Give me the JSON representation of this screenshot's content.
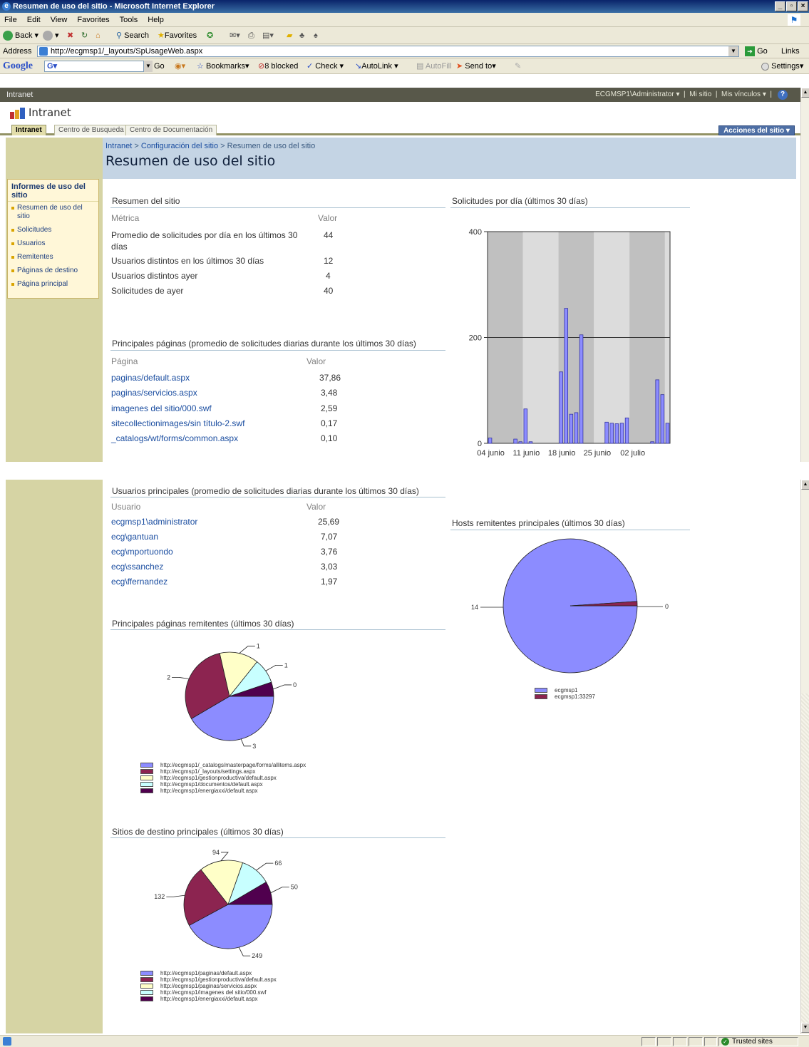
{
  "window": {
    "title": "Resumen de uso del sitio - Microsoft Internet Explorer"
  },
  "menu": [
    "File",
    "Edit",
    "View",
    "Favorites",
    "Tools",
    "Help"
  ],
  "toolbar": {
    "back": "Back",
    "search": "Search",
    "favorites": "Favorites"
  },
  "address": {
    "label": "Address",
    "url": "http://ecgmsp1/_layouts/SpUsageWeb.aspx",
    "go": "Go",
    "links": "Links"
  },
  "google": {
    "logo": "Google",
    "go": "Go",
    "bookmarks": "Bookmarks",
    "blocked": "8 blocked",
    "check": "Check",
    "autolink": "AutoLink",
    "autofill": "AutoFill",
    "sendto": "Send to",
    "settings": "Settings"
  },
  "sp": {
    "top_label": "Intranet",
    "user": "ECGMSP1\\Administrator",
    "mi_sitio": "Mi sitio",
    "mis_vinculos": "Mis vínculos",
    "site_title": "Intranet",
    "tabs": [
      "Intranet",
      "Centro de Busqueda",
      "Centro de Documentación"
    ],
    "acciones": "Acciones del sitio",
    "breadcrumb": {
      "a": "Intranet",
      "b": "Configuración del sitio",
      "c": "Resumen de uso del sitio",
      "sep": ">"
    },
    "page_title": "Resumen de uso del sitio"
  },
  "quick_launch": {
    "heading": "Informes de uso del sitio",
    "items": [
      "Resumen de uso del sitio",
      "Solicitudes",
      "Usuarios",
      "Remitentes",
      "Páginas de destino",
      "Página principal"
    ]
  },
  "resumen": {
    "heading": "Resumen del sitio",
    "col_metric": "Métrica",
    "col_value": "Valor",
    "rows": [
      {
        "metric": "Promedio de solicitudes por día en los últimos 30 días",
        "value": "44"
      },
      {
        "metric": "Usuarios distintos en los últimos 30 días",
        "value": "12"
      },
      {
        "metric": "Usuarios distintos ayer",
        "value": "4"
      },
      {
        "metric": "Solicitudes de ayer",
        "value": "40"
      }
    ]
  },
  "paginas": {
    "heading": "Principales páginas (promedio de solicitudes diarias durante los últimos 30 días)",
    "col_page": "Página",
    "col_value": "Valor",
    "rows": [
      {
        "page": "paginas/default.aspx",
        "value": "37,86"
      },
      {
        "page": "paginas/servicios.aspx",
        "value": "3,48"
      },
      {
        "page": "imagenes del sitio/000.swf",
        "value": "2,59"
      },
      {
        "page": "sitecollectionimages/sin título-2.swf",
        "value": "0,17"
      },
      {
        "page": "_catalogs/wt/forms/common.aspx",
        "value": "0,10"
      }
    ]
  },
  "usuarios": {
    "heading": "Usuarios principales (promedio de solicitudes diarias durante los últimos 30 días)",
    "col_user": "Usuario",
    "col_value": "Valor",
    "rows": [
      {
        "user": "ecgmsp1\\administrator",
        "value": "25,69"
      },
      {
        "user": "ecg\\gantuan",
        "value": "7,07"
      },
      {
        "user": "ecg\\mportuondo",
        "value": "3,76"
      },
      {
        "user": "ecg\\ssanchez",
        "value": "3,03"
      },
      {
        "user": "ecg\\ffernandez",
        "value": "1,97"
      }
    ]
  },
  "colors": {
    "blue": "#8c8cff",
    "maroon": "#8c2450",
    "yellow": "#ffffc8",
    "cyan": "#c8ffff",
    "purple": "#50004e",
    "band_dark": "#c0c0c0",
    "band_light": "#dcdcdc"
  },
  "chart_data": [
    {
      "type": "bar",
      "title": "Solicitudes por día (últimos 30 días)",
      "ylim": [
        0,
        400
      ],
      "yticks": [
        "0",
        "200",
        "400"
      ],
      "xticks": [
        "04 junio",
        "11 junio",
        "18 junio",
        "25 junio",
        "02 julio"
      ],
      "values": [
        10,
        0,
        0,
        0,
        0,
        8,
        3,
        65,
        3,
        0,
        0,
        0,
        0,
        0,
        135,
        255,
        55,
        58,
        205,
        0,
        0,
        0,
        0,
        40,
        38,
        37,
        38,
        48,
        0,
        0,
        0,
        0,
        3,
        120,
        92,
        38
      ]
    },
    {
      "type": "pie",
      "title": "Principales páginas remitentes (últimos 30 días)",
      "categories": [
        "http://ecgmsp1/_catalogs/masterpage/forms/allitems.aspx",
        "http://ecgmsp1/_layouts/settings.aspx",
        "http://ecgmsp1/gestionproductiva/default.aspx",
        "http://ecgmsp1/documentos/default.aspx",
        "http://ecgmsp1/energiaxxi/default.aspx"
      ],
      "labels": [
        "3",
        "2",
        "1",
        "1",
        "0"
      ],
      "values": [
        3.2,
        2.3,
        1.1,
        0.7,
        0.4
      ]
    },
    {
      "type": "pie",
      "title": "Sitios de destino principales (últimos 30 días)",
      "categories": [
        "http://ecgmsp1/paginas/default.aspx",
        "http://ecgmsp1/gestionproductiva/default.aspx",
        "http://ecgmsp1/paginas/servicios.aspx",
        "http://ecgmsp1/imagenes del sitio/000.swf",
        "http://ecgmsp1/energiaxxi/default.aspx"
      ],
      "values": [
        249,
        132,
        94,
        66,
        50
      ]
    },
    {
      "type": "pie",
      "title": "Hosts remitentes principales (últimos 30 días)",
      "categories": [
        "ecgmsp1",
        "ecgmsp1:33297"
      ],
      "labels": [
        "14",
        "0"
      ],
      "values": [
        14,
        0.15
      ]
    }
  ],
  "status": {
    "zone": "Trusted sites"
  }
}
